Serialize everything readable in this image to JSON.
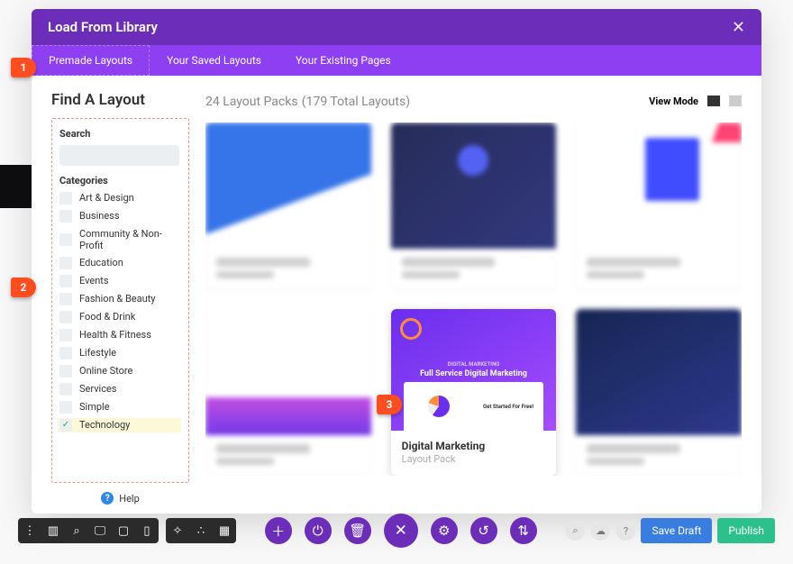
{
  "modal": {
    "title": "Load From Library",
    "tabs": [
      "Premade Layouts",
      "Your Saved Layouts",
      "Your Existing Pages"
    ]
  },
  "sidebar": {
    "heading": "Find A Layout",
    "search_label": "Search",
    "categories_label": "Categories",
    "categories": [
      "Art & Design",
      "Business",
      "Community & Non-Profit",
      "Education",
      "Events",
      "Fashion & Beauty",
      "Food & Drink",
      "Health & Fitness",
      "Lifestyle",
      "Online Store",
      "Services",
      "Simple",
      "Technology"
    ],
    "selected": "Technology",
    "help": "Help"
  },
  "main": {
    "count": "24 Layout Packs",
    "sub": "(179 Total Layouts)",
    "view_mode": "View Mode",
    "featured": {
      "title": "Digital Marketing",
      "subtitle": "Layout Pack",
      "thumb_title": "Full Service Digital Marketing",
      "thumb_tag": "DIGITAL MARKETING",
      "panel_right": "Get Started For Free!"
    }
  },
  "toolbar": {
    "save": "Save Draft",
    "publish": "Publish"
  },
  "markers": {
    "m1": "1",
    "m2": "2",
    "m3": "3"
  }
}
